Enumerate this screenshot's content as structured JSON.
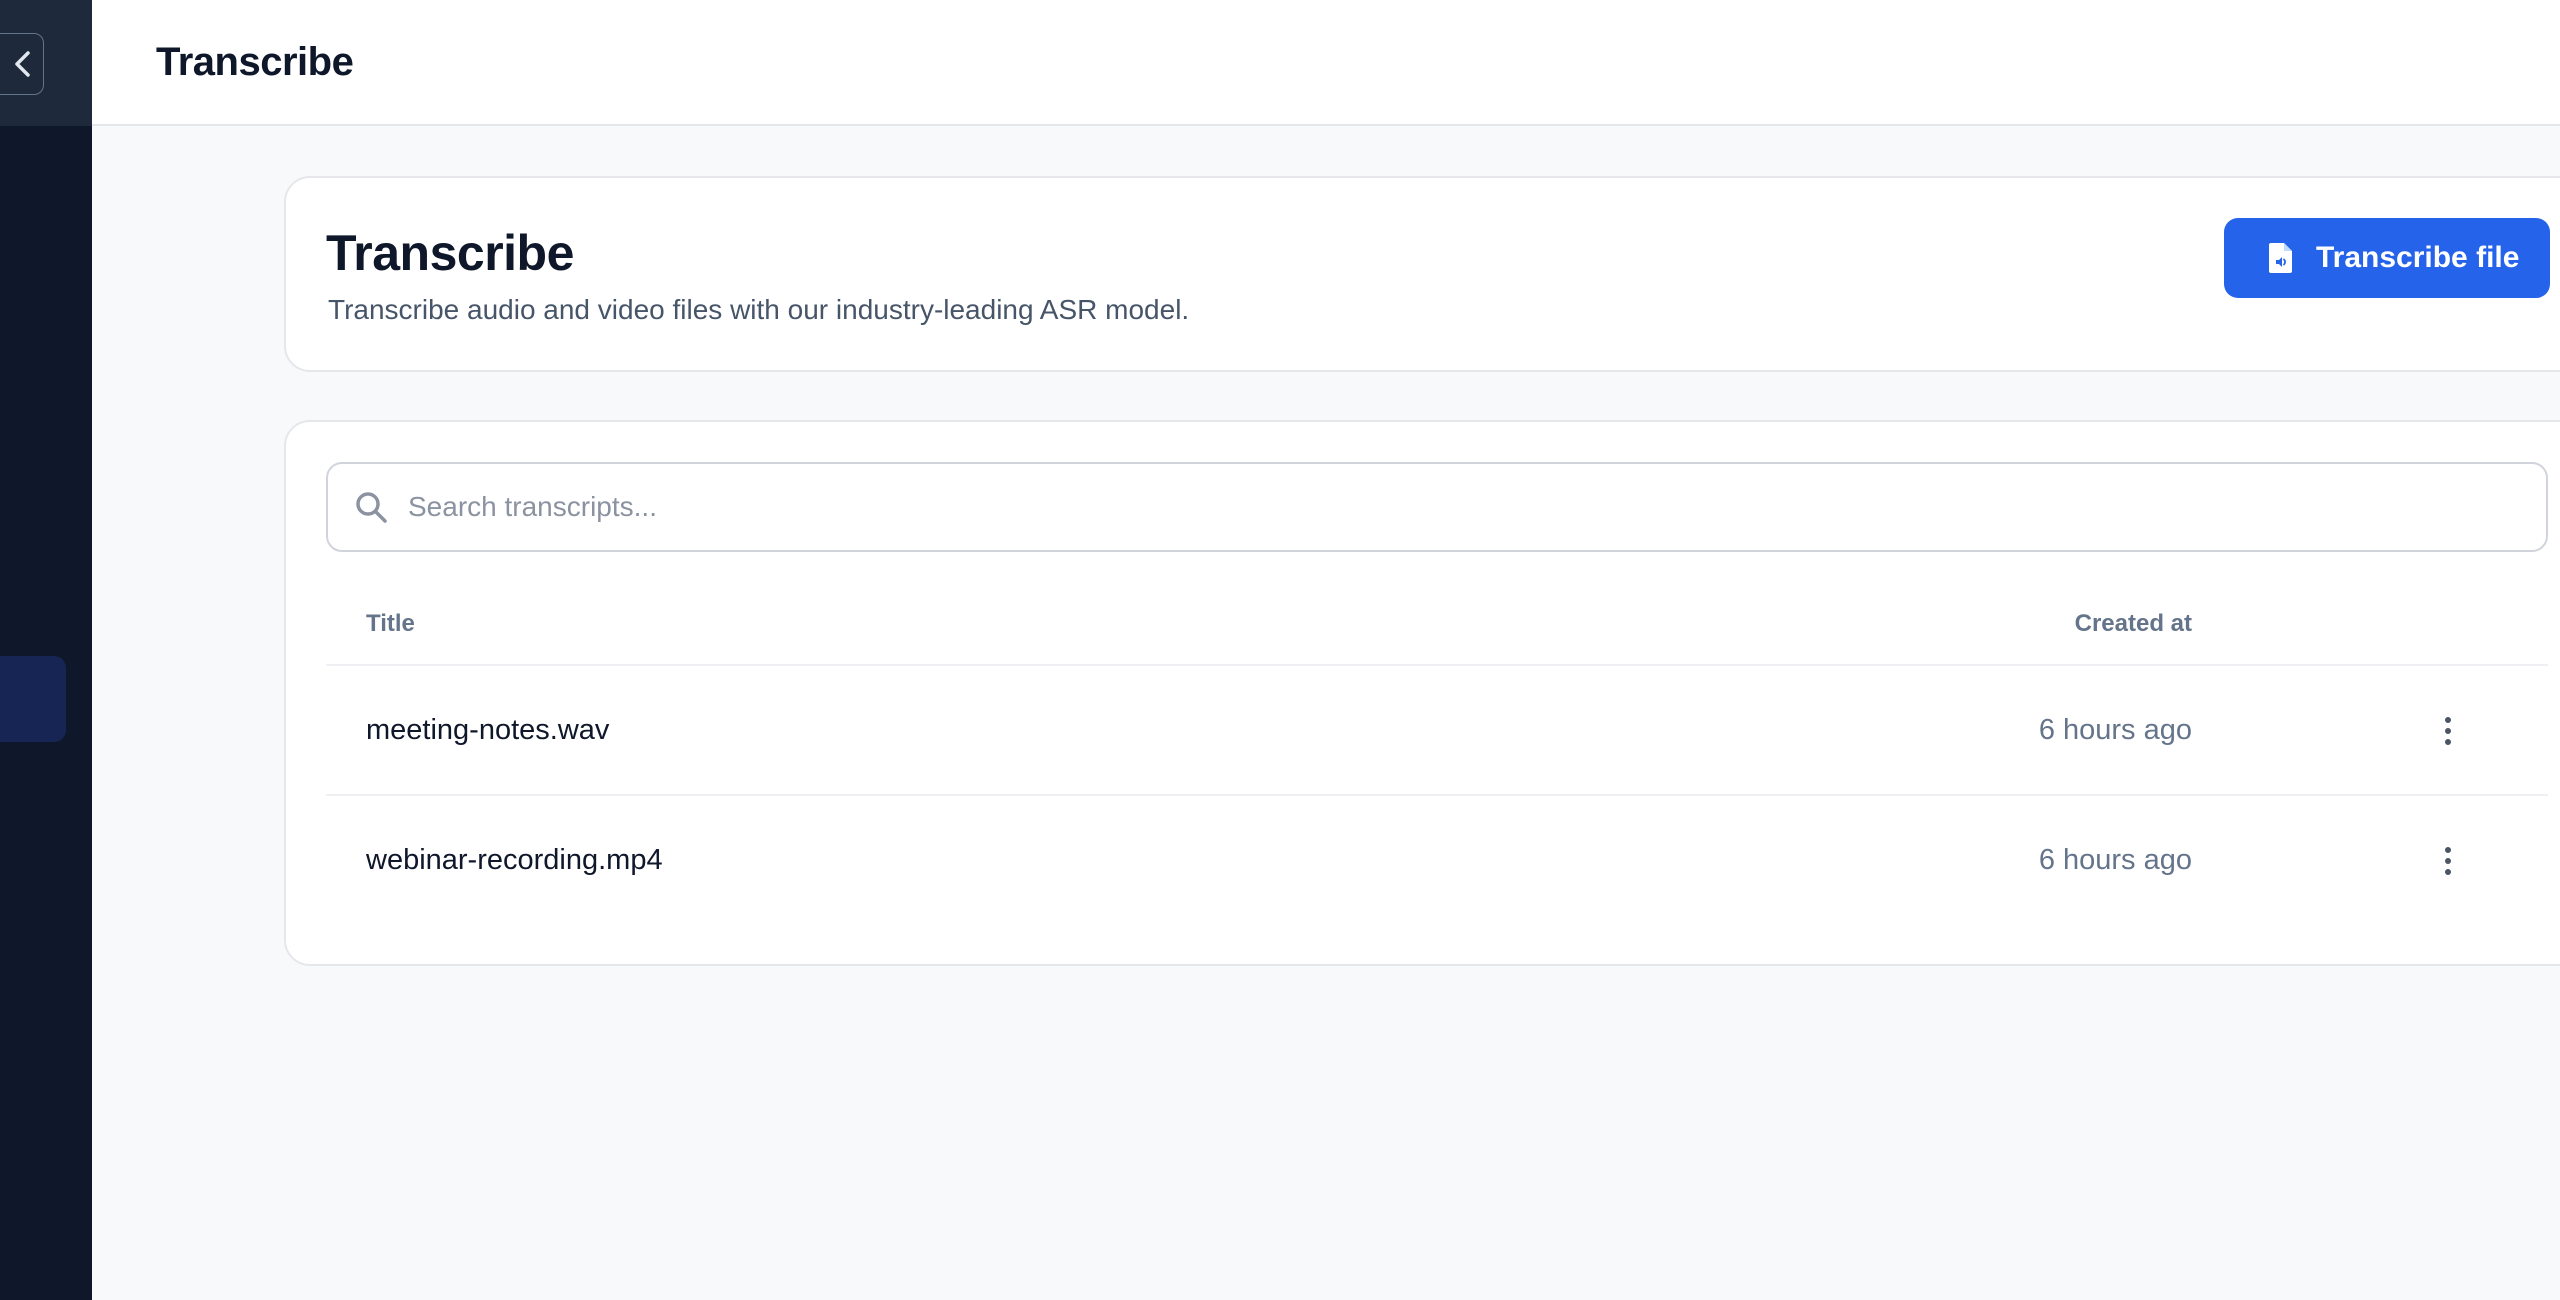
{
  "topbar": {
    "title": "Transcribe"
  },
  "header": {
    "title": "Transcribe",
    "description": "Transcribe audio and video files with our industry-leading ASR model.",
    "action_label": "Transcribe file",
    "action_icon": "file-audio-icon"
  },
  "search": {
    "placeholder": "Search transcripts...",
    "value": ""
  },
  "table": {
    "columns": {
      "title": "Title",
      "created_at": "Created at"
    },
    "rows": [
      {
        "title": "meeting-notes.wav",
        "created_at": "6 hours ago"
      },
      {
        "title": "webinar-recording.mp4",
        "created_at": "6 hours ago"
      }
    ]
  },
  "colors": {
    "sidebar": "#0f172a",
    "sidebar_top": "#1e293b",
    "primary": "#2563eb",
    "background": "#f8f9fb"
  }
}
